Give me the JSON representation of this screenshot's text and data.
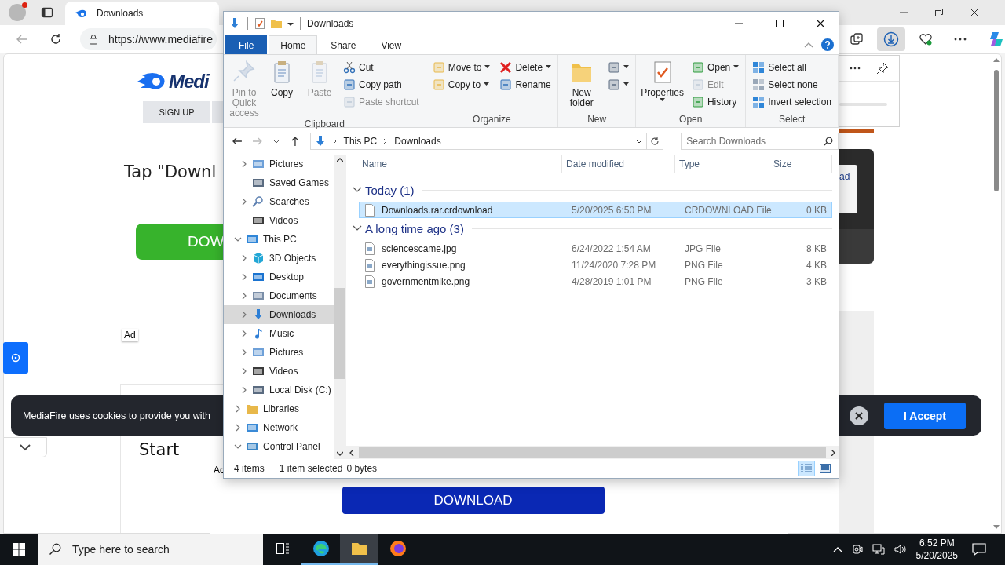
{
  "browser": {
    "tab": {
      "title": "Downloads"
    },
    "url": "https://www.mediafire",
    "page": {
      "logo_text": "Medi",
      "nav_buttons": [
        "SIGN UP"
      ],
      "heading": "Tap \"Downl",
      "cta_button": "DOW",
      "ad_label": "Ad",
      "lower_heading": "Start",
      "footer_ad_label": "Ac",
      "download_button": "DOWNLOAD",
      "side_ad_text": "ad"
    },
    "cookie_banner": {
      "text": "MediaFire uses cookies to provide you with",
      "accept_button": "I Accept"
    }
  },
  "explorer": {
    "title": "Downloads",
    "ribbon_tabs": [
      {
        "label": "File",
        "kind": "file",
        "selected": false
      },
      {
        "label": "Home",
        "kind": "tab",
        "selected": true
      },
      {
        "label": "Share",
        "kind": "tab",
        "selected": false
      },
      {
        "label": "View",
        "kind": "tab",
        "selected": false
      }
    ],
    "groups": [
      {
        "label": "Clipboard",
        "items": [
          {
            "kind": "large",
            "label": "Pin to Quick access",
            "disabled": true,
            "dropdown": false
          },
          {
            "kind": "large",
            "label": "Copy",
            "disabled": false,
            "dropdown": false
          },
          {
            "kind": "large",
            "label": "Paste",
            "disabled": true,
            "dropdown": false
          },
          {
            "kind": "stack",
            "commands": [
              {
                "kind": "small",
                "label": "Cut",
                "disabled": false,
                "dropdown": false
              },
              {
                "kind": "small",
                "label": "Copy path",
                "disabled": false,
                "dropdown": false
              },
              {
                "kind": "small",
                "label": "Paste shortcut",
                "disabled": true,
                "dropdown": false
              }
            ]
          }
        ]
      },
      {
        "label": "Organize",
        "items": [
          {
            "kind": "stack",
            "commands": [
              {
                "kind": "small",
                "label": "Move to",
                "disabled": false,
                "dropdown": true
              },
              {
                "kind": "small",
                "label": "Copy to",
                "disabled": false,
                "dropdown": true
              }
            ]
          },
          {
            "kind": "stack",
            "commands": [
              {
                "kind": "small",
                "label": "Delete",
                "disabled": false,
                "dropdown": true
              },
              {
                "kind": "small",
                "label": "Rename",
                "disabled": false,
                "dropdown": false
              }
            ]
          }
        ]
      },
      {
        "label": "New",
        "items": [
          {
            "kind": "large",
            "label": "New folder",
            "disabled": false,
            "dropdown": false
          },
          {
            "kind": "stack",
            "commands": [
              {
                "kind": "icon",
                "disabled": false,
                "dropdown": true
              },
              {
                "kind": "icon",
                "disabled": false,
                "dropdown": true
              }
            ]
          }
        ]
      },
      {
        "label": "Open",
        "items": [
          {
            "kind": "large",
            "label": "Properties",
            "disabled": false,
            "dropdown": true
          },
          {
            "kind": "stack",
            "commands": [
              {
                "kind": "small",
                "label": "Open",
                "disabled": false,
                "dropdown": true
              },
              {
                "kind": "small",
                "label": "Edit",
                "disabled": true,
                "dropdown": false
              },
              {
                "kind": "small",
                "label": "History",
                "disabled": false,
                "dropdown": false
              }
            ]
          }
        ]
      },
      {
        "label": "Select",
        "items": [
          {
            "kind": "stack",
            "commands": [
              {
                "kind": "small",
                "label": "Select all",
                "disabled": false,
                "dropdown": false
              },
              {
                "kind": "small",
                "label": "Select none",
                "disabled": false,
                "dropdown": false
              },
              {
                "kind": "small",
                "label": "Invert selection",
                "disabled": false,
                "dropdown": false
              }
            ]
          }
        ]
      }
    ],
    "path": [
      "This PC",
      "Downloads"
    ],
    "search": {
      "placeholder": "Search Downloads"
    },
    "nav_tree": [
      {
        "children": [
          {
            "label": "Pictures",
            "expandable": true,
            "expanded": false,
            "selected": false
          },
          {
            "label": "Saved Games",
            "expandable": false,
            "expanded": false,
            "selected": false
          },
          {
            "label": "Searches",
            "expandable": true,
            "expanded": false,
            "selected": false
          },
          {
            "label": "Videos",
            "expandable": false,
            "expanded": false,
            "selected": false
          }
        ]
      },
      {
        "label": "This PC",
        "expandable": true,
        "expanded": true,
        "selected": false,
        "children": [
          {
            "label": "3D Objects",
            "expandable": true,
            "expanded": false,
            "selected": false
          },
          {
            "label": "Desktop",
            "expandable": true,
            "expanded": false,
            "selected": false
          },
          {
            "label": "Documents",
            "expandable": true,
            "expanded": false,
            "selected": false
          },
          {
            "label": "Downloads",
            "expandable": true,
            "expanded": false,
            "selected": true
          },
          {
            "label": "Music",
            "expandable": true,
            "expanded": false,
            "selected": false
          },
          {
            "label": "Pictures",
            "expandable": true,
            "expanded": false,
            "selected": false
          },
          {
            "label": "Videos",
            "expandable": true,
            "expanded": false,
            "selected": false
          },
          {
            "label": "Local Disk (C:)",
            "expandable": true,
            "expanded": false,
            "selected": false
          }
        ]
      },
      {
        "label": "Libraries",
        "expandable": true,
        "expanded": false,
        "selected": false
      },
      {
        "label": "Network",
        "expandable": true,
        "expanded": false,
        "selected": false
      },
      {
        "label": "Control Panel",
        "expandable": true,
        "expanded": true,
        "selected": false
      }
    ],
    "columns": [
      "Name",
      "Date modified",
      "Type",
      "Size"
    ],
    "file_groups": [
      {
        "label": "Today (1)",
        "expanded": true,
        "files": [
          {
            "kind": "download",
            "name": "Downloads.rar.crdownload",
            "date": "5/20/2025 6:50 PM",
            "type": "CRDOWNLOAD File",
            "size": "0 KB",
            "selected": true
          }
        ]
      },
      {
        "label": "A long time ago (3)",
        "expanded": true,
        "files": [
          {
            "kind": "image",
            "name": "sciencescame.jpg",
            "date": "6/24/2022 1:54 AM",
            "type": "JPG File",
            "size": "8 KB",
            "selected": false
          },
          {
            "kind": "image",
            "name": "everythingissue.png",
            "date": "11/24/2020 7:28 PM",
            "type": "PNG File",
            "size": "4 KB",
            "selected": false
          },
          {
            "kind": "image",
            "name": "governmentmike.png",
            "date": "4/28/2019 1:01 PM",
            "type": "PNG File",
            "size": "3 KB",
            "selected": false
          }
        ]
      }
    ],
    "status": {
      "item_count": "4 items",
      "selection": "1 item selected",
      "selection_size": "0 bytes"
    },
    "view_buttons": [
      {
        "selected": true
      },
      {
        "selected": false
      }
    ]
  },
  "taskbar": {
    "search": {
      "placeholder": "Type here to search"
    },
    "apps": [
      {
        "running": true,
        "selected": false
      },
      {
        "running": true,
        "selected": true
      },
      {
        "running": false,
        "selected": false
      }
    ],
    "time": "6:52 PM",
    "date": "5/20/2025"
  }
}
